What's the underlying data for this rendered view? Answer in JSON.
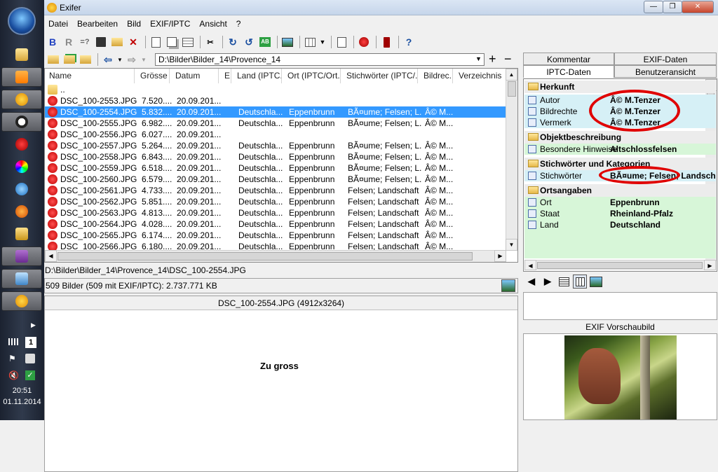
{
  "taskbar": {
    "time": "20:51",
    "date": "01.11.2014",
    "badge": "1"
  },
  "window": {
    "title": "Exifer",
    "min": "—",
    "max": "❐",
    "close": "✕"
  },
  "menu": [
    "Datei",
    "Bearbeiten",
    "Bild",
    "EXIF/IPTC",
    "Ansicht",
    "?"
  ],
  "toolbar": {
    "bold": "B",
    "redo": "R",
    "eq": "=?",
    "help": "?"
  },
  "path": {
    "current": "D:\\Bilder\\Bilder_14\\Provence_14"
  },
  "filelist": {
    "headers": [
      "Name",
      "Grösse",
      "Datum",
      "E",
      "Land (IPTC...",
      "Ort (IPTC/Ort...",
      "Stichwörter (IPTC/...",
      "Bildrec...",
      "Verzeichnis"
    ],
    "parent": "..",
    "rows": [
      [
        "DSC_100-2553.JPG",
        "7.520....",
        "20.09.201...",
        "",
        "",
        "",
        "",
        ""
      ],
      [
        "DSC_100-2554.JPG",
        "5.832....",
        "20.09.201...",
        "",
        "Deutschla...",
        "Eppenbrunn",
        "BÃ¤ume; Felsen; L...",
        "Â© M..."
      ],
      [
        "DSC_100-2555.JPG",
        "6.982....",
        "20.09.201...",
        "",
        "Deutschla...",
        "Eppenbrunn",
        "BÃ¤ume; Felsen; L...",
        "Â© M..."
      ],
      [
        "DSC_100-2556.JPG",
        "6.027....",
        "20.09.201...",
        "",
        "",
        "",
        "",
        ""
      ],
      [
        "DSC_100-2557.JPG",
        "5.264....",
        "20.09.201...",
        "",
        "Deutschla...",
        "Eppenbrunn",
        "BÃ¤ume; Felsen; L...",
        "Â© M..."
      ],
      [
        "DSC_100-2558.JPG",
        "6.843....",
        "20.09.201...",
        "",
        "Deutschla...",
        "Eppenbrunn",
        "BÃ¤ume; Felsen; L...",
        "Â© M..."
      ],
      [
        "DSC_100-2559.JPG",
        "6.518....",
        "20.09.201...",
        "",
        "Deutschla...",
        "Eppenbrunn",
        "BÃ¤ume; Felsen; L...",
        "Â© M..."
      ],
      [
        "DSC_100-2560.JPG",
        "6.579....",
        "20.09.201...",
        "",
        "Deutschla...",
        "Eppenbrunn",
        "BÃ¤ume; Felsen; L...",
        "Â© M..."
      ],
      [
        "DSC_100-2561.JPG",
        "4.733....",
        "20.09.201...",
        "",
        "Deutschla...",
        "Eppenbrunn",
        "Felsen; Landschaft",
        "Â© M..."
      ],
      [
        "DSC_100-2562.JPG",
        "5.851....",
        "20.09.201...",
        "",
        "Deutschla...",
        "Eppenbrunn",
        "Felsen; Landschaft",
        "Â© M..."
      ],
      [
        "DSC_100-2563.JPG",
        "4.813....",
        "20.09.201...",
        "",
        "Deutschla...",
        "Eppenbrunn",
        "Felsen; Landschaft",
        "Â© M..."
      ],
      [
        "DSC_100-2564.JPG",
        "4.028....",
        "20.09.201...",
        "",
        "Deutschla...",
        "Eppenbrunn",
        "Felsen; Landschaft",
        "Â© M..."
      ],
      [
        "DSC_100-2565.JPG",
        "6.174....",
        "20.09.201...",
        "",
        "Deutschla...",
        "Eppenbrunn",
        "Felsen; Landschaft",
        "Â© M..."
      ],
      [
        "DSC_100-2566.JPG",
        "6.180....",
        "20.09.201...",
        "",
        "Deutschla...",
        "Eppenbrunn",
        "Felsen; Landschaft",
        "Â© M..."
      ]
    ],
    "selected_index": 1
  },
  "status": {
    "file_path": "D:\\Bilder\\Bilder_14\\Provence_14\\DSC_100-2554.JPG",
    "summary": "509 Bilder (509 mit EXIF/IPTC): 2.737.771 KB"
  },
  "preview": {
    "title": "DSC_100-2554.JPG (4912x3264)",
    "message": "Zu gross"
  },
  "tabs": {
    "kommentar": "Kommentar",
    "exif": "EXIF-Daten",
    "iptc": "IPTC-Daten",
    "benutzer": "Benutzeransicht"
  },
  "iptc": {
    "herkunft": "Herkunft",
    "autor_label": "Autor",
    "autor_value": "Â© M.Tenzer",
    "bildrechte_label": "Bildrechte",
    "bildrechte_value": "Â© M.Tenzer",
    "vermerk_label": "Vermerk",
    "vermerk_value": "Â© M.Tenzer",
    "objekt": "Objektbeschreibung",
    "hinweise_label": "Besondere Hinweise",
    "hinweise_value": "Altschlossfelsen",
    "stich_group": "Stichwörter und Kategorien",
    "stich_label": "Stichwörter",
    "stich_value": "BÃ¤ume; Felsen; Landsch",
    "orts": "Ortsangaben",
    "ort_label": "Ort",
    "ort_value": "Eppenbrunn",
    "staat_label": "Staat",
    "staat_value": "Rheinland-Pfalz",
    "land_label": "Land",
    "land_value": "Deutschland"
  },
  "exif_preview_title": "EXIF Vorschaubild",
  "colors": {
    "selection": "#3399ff",
    "highlight_ring": "#e00000",
    "iptc_blue": "#d6f0f6",
    "iptc_green": "#d7f6d8"
  }
}
